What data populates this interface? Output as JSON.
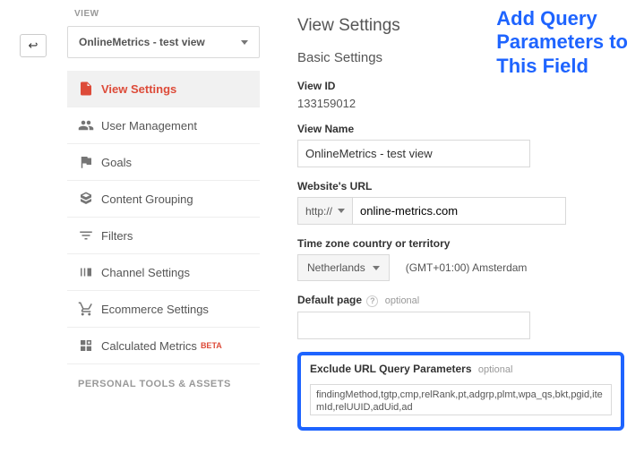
{
  "sidebar": {
    "sectionLabel": "VIEW",
    "selectorText": "OnlineMetrics - test view",
    "items": [
      {
        "label": "View Settings"
      },
      {
        "label": "User Management"
      },
      {
        "label": "Goals"
      },
      {
        "label": "Content Grouping"
      },
      {
        "label": "Filters"
      },
      {
        "label": "Channel Settings"
      },
      {
        "label": "Ecommerce Settings"
      },
      {
        "label": "Calculated Metrics"
      }
    ],
    "betaTag": "BETA",
    "personalSection": "PERSONAL TOOLS & ASSETS"
  },
  "main": {
    "title": "View Settings",
    "subtitle": "Basic Settings",
    "viewIdLabel": "View ID",
    "viewIdValue": "133159012",
    "viewNameLabel": "View Name",
    "viewNameValue": "OnlineMetrics - test view",
    "urlLabel": "Website's URL",
    "urlPrefix": "http://",
    "urlValue": "online-metrics.com",
    "tzLabel": "Time zone country or territory",
    "tzCountry": "Netherlands",
    "tzText": "(GMT+01:00) Amsterdam",
    "defaultPageLabel": "Default page",
    "defaultPageValue": "",
    "optionalText": "optional",
    "excludeLabel": "Exclude URL Query Parameters",
    "excludeValue": "findingMethod,tgtp,cmp,relRank,pt,adgrp,plmt,wpa_qs,bkt,pgid,itemId,relUUID,adUid,ad"
  },
  "annotation": {
    "line1": "Add Query",
    "line2": "Parameters to",
    "line3": "This Field"
  }
}
